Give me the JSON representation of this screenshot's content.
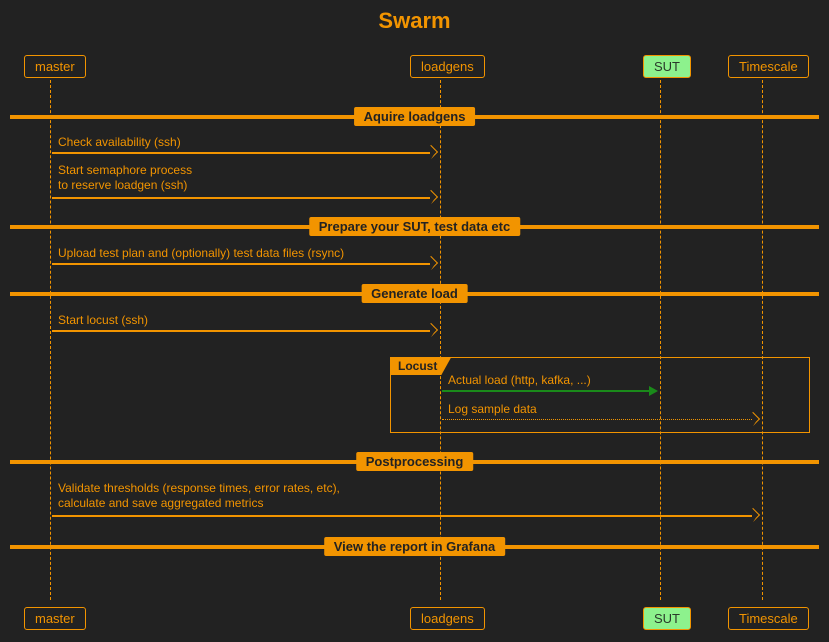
{
  "title": "Swarm",
  "participants": {
    "master": "master",
    "loadgens": "loadgens",
    "sut": "SUT",
    "timescale": "Timescale"
  },
  "dividers": {
    "aquire": "Aquire loadgens",
    "prepare": "Prepare your SUT, test data etc",
    "generate": "Generate load",
    "post": "Postprocessing",
    "view": "View the report in Grafana"
  },
  "messages": {
    "check": "Check availability (ssh)",
    "semaphore": "Start semaphore process\nto reserve loadgen (ssh)",
    "upload": "Upload test plan and (optionally) test data files (rsync)",
    "start_locust": "Start locust (ssh)",
    "actual_load": "Actual load (http, kafka, ...)",
    "log_sample": "Log sample data",
    "validate": "Validate thresholds (response times, error rates, etc),\ncalculate and save aggregated metrics"
  },
  "box_label": "Locust"
}
